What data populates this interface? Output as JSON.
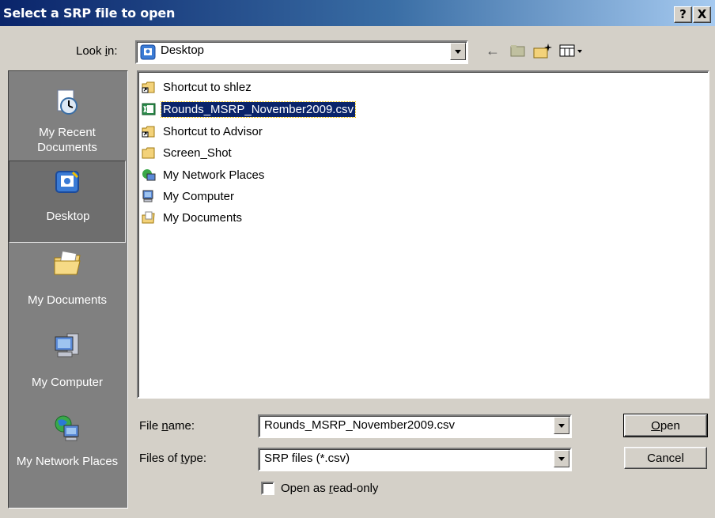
{
  "window": {
    "title": "Select a SRP file to open",
    "help_button": "?",
    "close_button": "X"
  },
  "toolbar": {
    "lookin_label": "Look in:",
    "lookin_value": "Desktop",
    "icons": [
      "back-arrow-icon",
      "up-folder-icon",
      "new-folder-icon",
      "view-menu-icon"
    ]
  },
  "places": [
    {
      "label": "My Recent Documents",
      "icon": "recent-documents-icon"
    },
    {
      "label": "Desktop",
      "icon": "desktop-icon"
    },
    {
      "label": "My Documents",
      "icon": "my-documents-icon"
    },
    {
      "label": "My Computer",
      "icon": "my-computer-icon"
    },
    {
      "label": "My Network Places",
      "icon": "network-places-icon"
    }
  ],
  "files": [
    {
      "name": "Shortcut to shlez",
      "icon": "folder-shortcut-icon"
    },
    {
      "name": "Rounds_MSRP_November2009.csv",
      "icon": "csv-file-icon",
      "selected": true
    },
    {
      "name": "Shortcut to Advisor",
      "icon": "folder-shortcut-icon"
    },
    {
      "name": "Screen_Shot",
      "icon": "folder-icon"
    },
    {
      "name": "My Network Places",
      "icon": "network-places-icon"
    },
    {
      "name": "My Computer",
      "icon": "my-computer-icon"
    },
    {
      "name": "My Documents",
      "icon": "my-documents-icon"
    }
  ],
  "form": {
    "filename_label": "File name:",
    "filename_value": "Rounds_MSRP_November2009.csv",
    "filetype_label": "Files of type:",
    "filetype_value": "SRP files (*.csv)",
    "readonly_label": "Open as read-only",
    "readonly_checked": false
  },
  "buttons": {
    "open": "Open",
    "cancel": "Cancel"
  }
}
